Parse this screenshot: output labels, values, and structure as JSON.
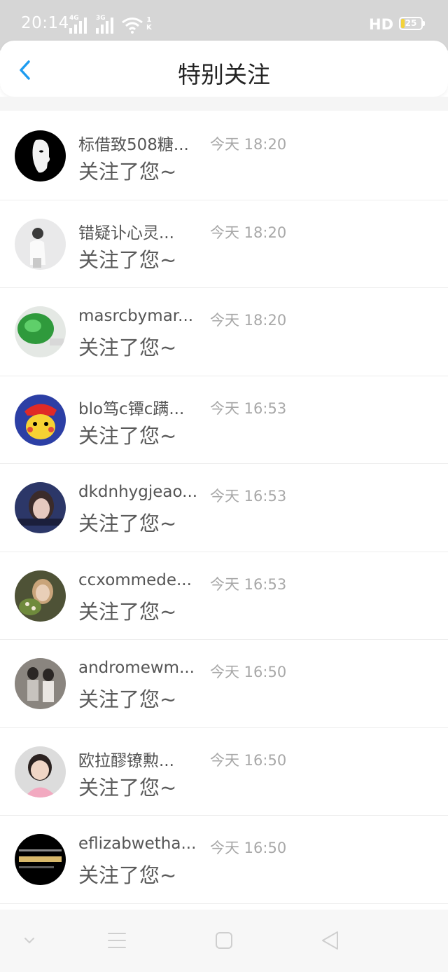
{
  "status_bar": {
    "time": "20:14",
    "signal1_label": "4G",
    "signal2_label": "3G",
    "net_speed_value": "1",
    "net_speed_unit": "K",
    "hd_label": "HD",
    "battery_level": "25",
    "battery_fill_color": "#f3d33a"
  },
  "header": {
    "title": "特别关注",
    "back_icon": "chevron-left-icon",
    "accent_color": "#1e9cf0"
  },
  "list": {
    "items": [
      {
        "name": "标借致508糖...",
        "time": "今天 18:20",
        "message": "关注了您~"
      },
      {
        "name": "错疑讣心灵...",
        "time": "今天 18:20",
        "message": "关注了您~"
      },
      {
        "name": "masrcbymar...",
        "time": "今天 18:20",
        "message": "关注了您~"
      },
      {
        "name": "blo笃c镡c蹒...",
        "time": "今天 16:53",
        "message": "关注了您~"
      },
      {
        "name": "dkdnhygjeao...",
        "time": "今天 16:53",
        "message": "关注了您~"
      },
      {
        "name": "ccxommede...",
        "time": "今天 16:53",
        "message": "关注了您~"
      },
      {
        "name": "andromewm...",
        "time": "今天 16:50",
        "message": "关注了您~"
      },
      {
        "name": "欧拉醪镣勲...",
        "time": "今天 16:50",
        "message": "关注了您~"
      },
      {
        "name": "eflizabwetha...",
        "time": "今天 16:50",
        "message": "关注了您~"
      }
    ]
  },
  "navbar": {
    "buttons": [
      "chevron-down-icon",
      "menu-icon",
      "home-square-icon",
      "back-triangle-icon"
    ]
  }
}
